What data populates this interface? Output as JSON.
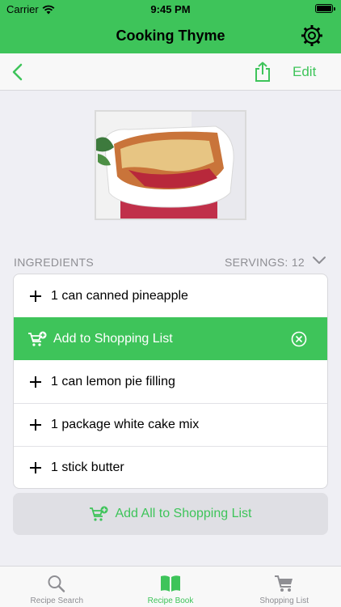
{
  "status": {
    "carrier": "Carrier",
    "time": "9:45 PM"
  },
  "app": {
    "title": "Cooking Thyme"
  },
  "toolbar": {
    "edit_label": "Edit"
  },
  "ingredients": {
    "header": "INGREDIENTS",
    "servings": "SERVINGS: 12",
    "items": [
      "1 can canned pineapple",
      "1 can lemon pie filling",
      "1 package white cake mix",
      "1 stick butter"
    ],
    "add_to_list_label": "Add to Shopping List"
  },
  "add_all_label": "Add All to Shopping List",
  "tabs": [
    {
      "label": "Recipe Search",
      "icon": "search-icon"
    },
    {
      "label": "Recipe Book",
      "icon": "book-icon"
    },
    {
      "label": "Shopping List",
      "icon": "cart-icon"
    }
  ],
  "colors": {
    "accent": "#3ec45a",
    "background": "#efeff4"
  }
}
